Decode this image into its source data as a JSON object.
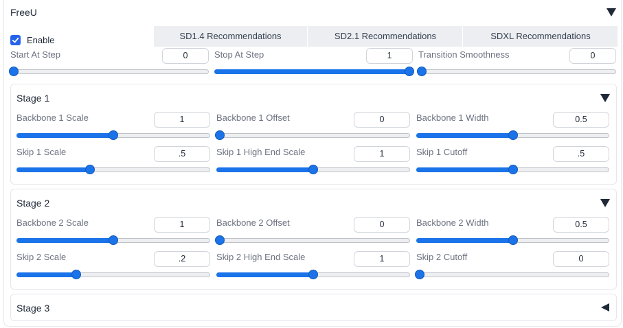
{
  "title": "FreeU",
  "enable": {
    "label": "Enable",
    "checked": true
  },
  "presets": [
    "SD1.4 Recommendations",
    "SD2.1 Recommendations",
    "SDXL Recommendations"
  ],
  "top_sliders": [
    {
      "label": "Start At Step",
      "value": "0",
      "fraction": 0.0
    },
    {
      "label": "Stop At Step",
      "value": "1",
      "fraction": 1.0
    },
    {
      "label": "Transition Smoothness",
      "value": "0",
      "fraction": 0.0
    }
  ],
  "stages": [
    {
      "title": "Stage 1",
      "expanded": true,
      "sliders": [
        {
          "label": "Backbone 1 Scale",
          "value": "1",
          "fraction": 0.5
        },
        {
          "label": "Backbone 1 Offset",
          "value": "0",
          "fraction": 0.0
        },
        {
          "label": "Backbone 1 Width",
          "value": "0.5",
          "fraction": 0.5
        },
        {
          "label": "Skip 1 Scale",
          "value": ".5",
          "fraction": 0.38
        },
        {
          "label": "Skip 1 High End Scale",
          "value": "1",
          "fraction": 0.5
        },
        {
          "label": "Skip 1 Cutoff",
          "value": ".5",
          "fraction": 0.5
        }
      ]
    },
    {
      "title": "Stage 2",
      "expanded": true,
      "sliders": [
        {
          "label": "Backbone 2 Scale",
          "value": "1",
          "fraction": 0.5
        },
        {
          "label": "Backbone 2 Offset",
          "value": "0",
          "fraction": 0.0
        },
        {
          "label": "Backbone 2 Width",
          "value": "0.5",
          "fraction": 0.5
        },
        {
          "label": "Skip 2 Scale",
          "value": ".2",
          "fraction": 0.31
        },
        {
          "label": "Skip 2 High End Scale",
          "value": "1",
          "fraction": 0.5
        },
        {
          "label": "Skip 2 Cutoff",
          "value": "0",
          "fraction": 0.0
        }
      ]
    },
    {
      "title": "Stage 3",
      "expanded": false
    }
  ],
  "colors": {
    "accent": "#1a73e8",
    "checkbox": "#2563eb"
  },
  "icons": {
    "expanded": "triangle-down-icon",
    "collapsed": "triangle-left-icon",
    "check": "check-icon"
  }
}
